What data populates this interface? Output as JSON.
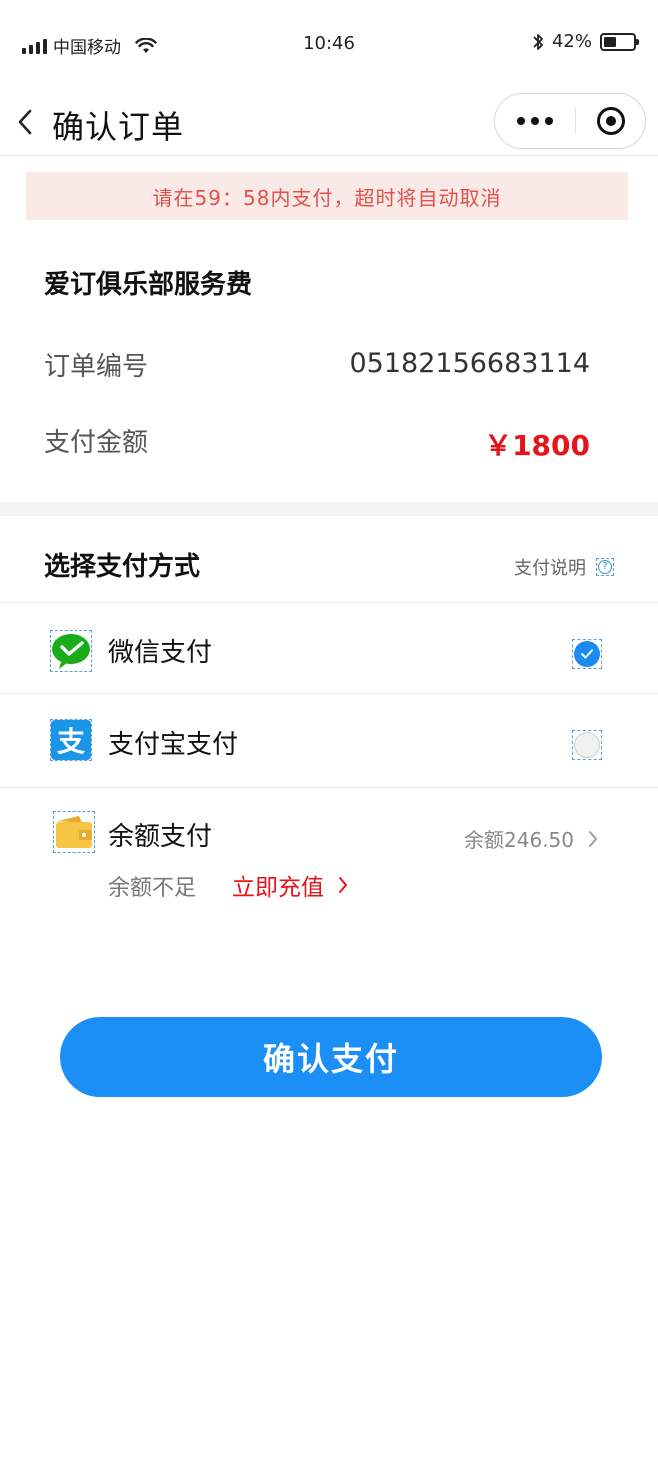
{
  "status_bar": {
    "carrier": "中国移动",
    "time": "10:46",
    "battery": "42%",
    "battery_level": 0.42
  },
  "nav": {
    "title": "确认订单"
  },
  "notice": {
    "text": "请在59：58内支付，超时将自动取消"
  },
  "order": {
    "title": "爱订俱乐部服务费",
    "number_label": "订单编号",
    "number_value": "05182156683114",
    "amount_label": "支付金额",
    "amount_value": "￥1800"
  },
  "payment": {
    "header": "选择支付方式",
    "help_label": "支付说明",
    "methods": [
      {
        "label": "微信支付",
        "icon": "wechat-pay-icon",
        "selected": true
      },
      {
        "label": "支付宝支付",
        "icon": "alipay-icon",
        "selected": false
      },
      {
        "label": "余额支付",
        "icon": "wallet-icon",
        "selected": false
      }
    ],
    "balance_text": "余额246.50",
    "balance_insufficient": "余额不足",
    "recharge_label": "立即充值"
  },
  "actions": {
    "confirm_label": "确认支付"
  },
  "colors": {
    "accent": "#1b8ff5",
    "price": "#e5141b",
    "notice_bg": "#f9e9e7",
    "notice_text": "#e2514a",
    "wechat": "#1aad19",
    "alipay": "#1a96e8",
    "wallet": "#f7c544"
  }
}
